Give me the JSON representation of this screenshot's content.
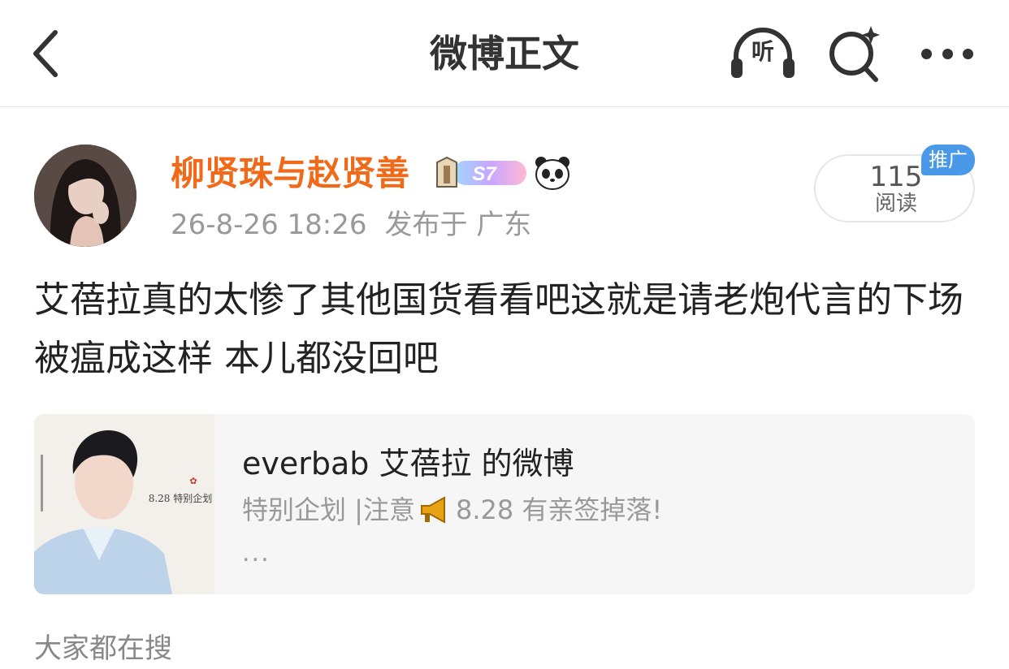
{
  "header": {
    "title": "微博正文",
    "listen_label": "听"
  },
  "author": {
    "name": "柳贤珠与赵贤善",
    "level_badge": "S7",
    "timestamp": "26-8-26 18:26",
    "location": "发布于 广东"
  },
  "read_stats": {
    "count": "115",
    "label": "阅读",
    "promo_tag": "推广"
  },
  "post": {
    "text": "艾蓓拉真的太惨了其他国货看看吧这就是请老炮代言的下场 被瘟成这样 本儿都没回吧"
  },
  "link_card": {
    "title": "everbab 艾蓓拉 的微博",
    "desc_before": "特别企划 |注意",
    "desc_after": "8.28 有亲签掉落!",
    "more": "...",
    "thumb_text": "8.28 特别企划"
  },
  "section": {
    "title": "大家都在搜"
  },
  "colors": {
    "accent_orange": "#f06a1a",
    "promo_blue": "#4a98e8",
    "card_bg": "#f6f6f6"
  },
  "icons": [
    "back-arrow-icon",
    "headphones-icon",
    "search-sparkle-icon",
    "more-dots-icon",
    "level-badge-icon",
    "panda-icon",
    "megaphone-icon"
  ]
}
